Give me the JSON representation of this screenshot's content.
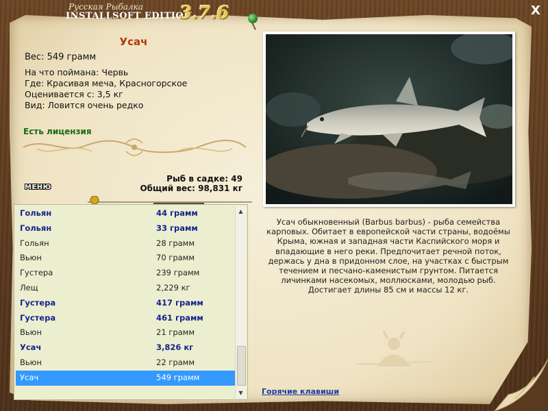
{
  "titlebar": {
    "subtitle": "Русская Рыбалка",
    "edition": "INSTALLSOFT EDITION",
    "version": "3.7.6",
    "close_label": "X"
  },
  "fish": {
    "name": "Усач",
    "weight": "Вес: 549 грамм",
    "bait": "На что поймана: Червь",
    "location": "Где: Красивая меча, Красногорское",
    "price": "Оценивается с: 3,5 кг",
    "rarity": "Вид: Ловится очень редко"
  },
  "license": "Есть лицензия",
  "stats": {
    "count": "Рыб в садке: 49",
    "total_weight": "Общий вес: 98,831 кг"
  },
  "menu_label": "МЕНЮ",
  "catch_list": [
    {
      "name": "Гольян",
      "weight": "44 грамм",
      "bold": true
    },
    {
      "name": "Гольян",
      "weight": "33 грамм",
      "bold": true
    },
    {
      "name": "Гольян",
      "weight": "28 грамм",
      "bold": false
    },
    {
      "name": "Вьюн",
      "weight": "70 грамм",
      "bold": false
    },
    {
      "name": "Густера",
      "weight": "239 грамм",
      "bold": false
    },
    {
      "name": "Лещ",
      "weight": "2,229 кг",
      "bold": false
    },
    {
      "name": "Густера",
      "weight": "417 грамм",
      "bold": true
    },
    {
      "name": "Густера",
      "weight": "461 грамм",
      "bold": true
    },
    {
      "name": "Вьюн",
      "weight": "21 грамм",
      "bold": false
    },
    {
      "name": "Усач",
      "weight": "3,826 кг",
      "bold": true
    },
    {
      "name": "Вьюн",
      "weight": "22 грамм",
      "bold": false
    },
    {
      "name": "Усач",
      "weight": "549 грамм",
      "bold": false,
      "selected": true
    }
  ],
  "description": "Усач обыкновенный (Barbus barbus) - рыба семейства карповых. Обитает в европейской части страны, водоёмы Крыма, южная и западная части Каспийского моря и впадающие в него реки. Предпочитает речной поток, держась у дна в придонном слое, на участках с быстрым течением и песчано-каменистым грунтом. Питается личинками насекомых, моллюсками, молодью рыб. Достигает длины 85 см и массы 12 кг.",
  "hotkeys_label": "Горячие клавиши",
  "colors": {
    "fish_name": "#b23a0a",
    "license": "#1a6a12",
    "bold_row": "#14248c",
    "selection": "#3399ff",
    "version": "#e8c45a"
  }
}
